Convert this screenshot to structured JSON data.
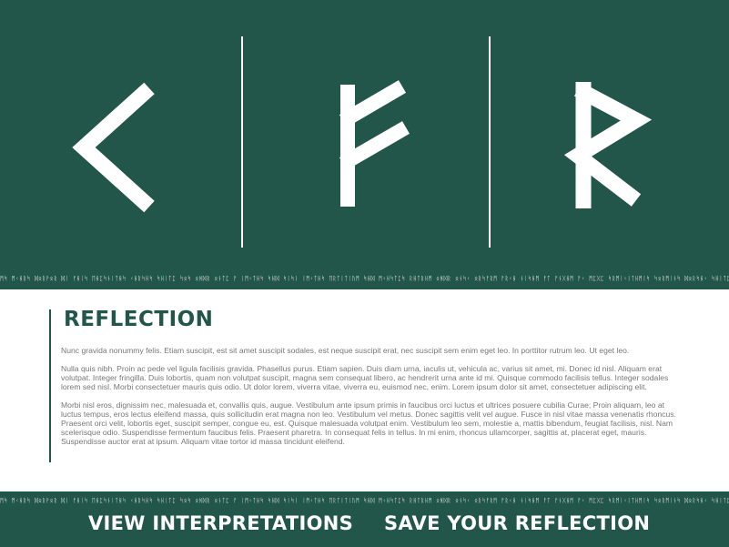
{
  "runes": [
    {
      "icon": "kaunan-rune-icon"
    },
    {
      "icon": "fehu-rune-icon"
    },
    {
      "icon": "raido-rune-icon"
    }
  ],
  "rune_strip_text": "ᛗᛋ ᛗᚲᚺᚱᛋ ᛞᛟᚱᚹᛟᚱ ᛞᛁ ᚠᚺᛁᛋ ᛖᚺᛈᛋᚾᛁᛏᚺᛋ ᚲᚺᚱᛋᚺᛋ ᛋᚺᛁᛏᛈ ᛋᛟᛋ ᛟᚻᛞᚱ ᛟᚾᛏᛈ ᚠ ᛁᛗᚲᛏᚺᛋ ᛋᚺᛞ ᛋᛁᛋᛁ ᛁᛗᚲᛏᚺᛋ ᛖᚱᛏᛁᛏᛁᚢᛗ ᛋᚺᛞ ᛗᚲᚺᛋᛏᛈᛋ ᚱᚺᛏᚱᚺᛗ ᛟᚻᛞᚱ ᛟᚾᛋᚲ ᛟᚱᛋᚠᚱᛗ ᚠᚱᚲᚺ ᚾᛁᛋᚺᛗ ᚠᛏ ᚠᚾᚷᚺᛗ ᚠᚲ ᛗᛈᚷᛈ ᛋᚱᛗᛁᚲᛁᛏᚺᛗᛁᛋ ᛋᛟᚱᛗᛁᚾᛋ ᛞᛟᚱᛋᚺᚲ ᛋᚺᛁᛏᛈ ᛖᚾᛋᛏᚱ",
  "reflection": {
    "title": "REFLECTION",
    "paragraphs": [
      "Nunc gravida nonummy felis. Etiam suscipit, est sit amet suscipit sodales, est neque suscipit erat, nec suscipit sem enim eget leo. In porttitor rutrum leo. Ut eget leo.",
      "Nulla quis nibh. Proin ac pede vel ligula facilisis gravida. Phasellus purus. Etiam sapien. Duis diam urna, iaculis ut, vehicula ac, varius sit amet, mi. Donec id nisl. Aliquam erat volutpat. Integer fringilla. Duis lobortis, quam non volutpat suscipit, magna sem consequat libero, ac hendrerit urna ante id mi. Quisque commodo facilisis tellus. Integer sodales lorem sed nisl. Morbi consectetuer mauris quis odio. Ut dolor lorem, viverra vitae, viverra eu, euismod nec, enim. Lorem ipsum dolor sit amet, consectetuer adipiscing elit.",
      "Morbi nisl eros, dignissim nec, malesuada et, convallis quis, augue. Vestibulum ante ipsum primis in faucibus orci luctus et ultrices posuere cubilia Curae; Proin aliquam, leo at luctus tempus, eros lectus eleifend massa, quis sollicitudin erat magna non leo. Vestibulum vel metus. Donec sagittis velit vel augue. Fusce in nisl vitae massa venenatis rhoncus. Praesent orci velit, lobortis eget, suscipit semper, congue eu, est. Quisque malesuada volutpat enim. Vestibulum leo sem, molestie a, mattis bibendum, feugiat facilisis, nisl. Nam scelerisque odio. Suspendisse fermentum faucibus felis. Praesent pharetra. In consequat felis in tellus. In mi enim, rhoncus ullamcorper, sagittis at, placerat eget, mauris. Suspendisse auctor erat at ipsum. Aliquam vitae tortor id massa tincidunt eleifend."
    ]
  },
  "footer": {
    "view_label": "VIEW INTERPRETATIONS",
    "save_label": "SAVE YOUR REFLECTION"
  },
  "colors": {
    "background": "#23564a",
    "panel": "#ffffff",
    "title": "#23564a",
    "body_text": "#777777",
    "rune": "#ffffff"
  }
}
